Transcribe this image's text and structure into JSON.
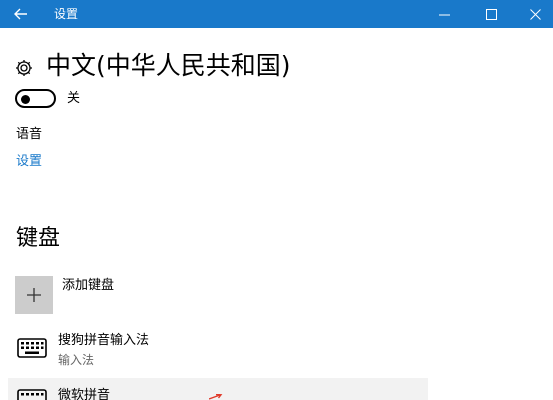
{
  "window": {
    "title": "设置"
  },
  "page": {
    "title": "中文(中华人民共和国)"
  },
  "toggle": {
    "state_label": "关",
    "on": false
  },
  "language": {
    "label": "语音",
    "link": "设置"
  },
  "keyboard": {
    "section_title": "键盘",
    "add_label": "添加键盘",
    "items": [
      {
        "name": "搜狗拼音输入法",
        "sub": "输入法"
      },
      {
        "name": "微软拼音"
      }
    ]
  },
  "colors": {
    "accent": "#1979ca",
    "tile": "#cccccc",
    "arrow": "#e03a2a"
  },
  "icons": [
    "back-arrow-icon",
    "minimize-icon",
    "maximize-icon",
    "close-icon",
    "gear-icon",
    "plus-icon",
    "keyboard-icon"
  ]
}
